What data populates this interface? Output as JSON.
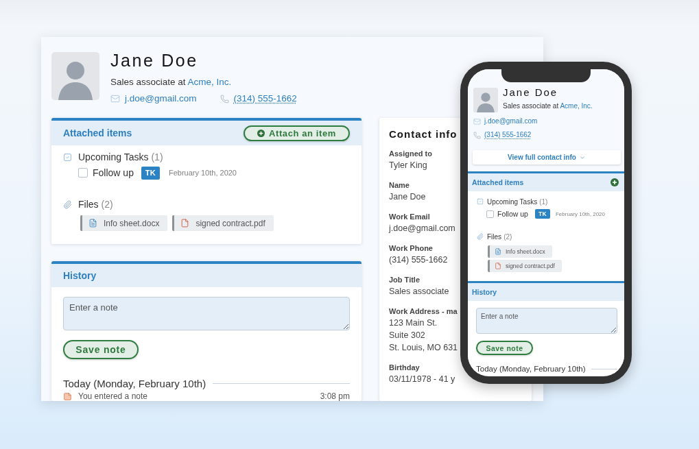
{
  "profile": {
    "name": "Jane Doe",
    "title_prefix": "Sales associate at",
    "company": "Acme, Inc.",
    "email": "j.doe@gmail.com",
    "phone": "(314) 555-1662"
  },
  "attached_items": {
    "title": "Attached items",
    "attach_button": "Attach an item",
    "tasks": {
      "label": "Upcoming Tasks",
      "count": "(1)",
      "items": [
        {
          "label": "Follow up",
          "checked": false,
          "assignee": "TK",
          "date": "February 10th, 2020"
        }
      ]
    },
    "files": {
      "label": "Files",
      "count": "(2)",
      "items": [
        {
          "name": "Info sheet.docx",
          "kind": "docx"
        },
        {
          "name": "signed contract.pdf",
          "kind": "pdf"
        }
      ]
    }
  },
  "history": {
    "title": "History",
    "note_placeholder": "Enter a note",
    "save_button": "Save note",
    "days": [
      {
        "heading": "Today (Monday, February 10th)",
        "entries": [
          {
            "text": "You entered a note",
            "time": "3:08 pm"
          }
        ]
      }
    ]
  },
  "contact_info": {
    "title": "Contact info",
    "fields": [
      {
        "label": "Assigned to",
        "lines": [
          "Tyler King"
        ]
      },
      {
        "label": "Name",
        "lines": [
          "Jane Doe"
        ]
      },
      {
        "label": "Work Email",
        "lines": [
          "j.doe@gmail.com"
        ]
      },
      {
        "label": "Work Phone",
        "lines": [
          "(314) 555-1662"
        ]
      },
      {
        "label": "Job Title",
        "lines": [
          "Sales associate"
        ]
      },
      {
        "label": "Work Address - ma",
        "lines": [
          "123 Main St.",
          "Suite 302",
          "St. Louis, MO 631"
        ]
      },
      {
        "label": "Birthday",
        "lines": [
          "03/11/1978 - 41 y"
        ]
      }
    ]
  },
  "mobile": {
    "profile": {
      "name": "Jane Doe",
      "title_prefix": "Sales associate at",
      "company": "Acme, Inc.",
      "email": "j.doe@gmail.com",
      "phone": "(314) 555-1662"
    },
    "view_contact_button": "View full contact info",
    "attached_items": {
      "title": "Attached items",
      "tasks": {
        "label": "Upcoming Tasks",
        "count": "(1)",
        "items": [
          {
            "label": "Follow up",
            "checked": false,
            "assignee": "TK",
            "date": "February 10th, 2020"
          }
        ]
      },
      "files": {
        "label": "Files",
        "count": "(2)",
        "items": [
          {
            "name": "Info sheet.docx",
            "kind": "docx"
          },
          {
            "name": "signed contract.pdf",
            "kind": "pdf"
          }
        ]
      }
    },
    "history": {
      "title": "History",
      "note_placeholder": "Enter a note",
      "save_button": "Save note",
      "days": [
        {
          "heading": "Today (Monday, February 10th)"
        }
      ]
    }
  }
}
